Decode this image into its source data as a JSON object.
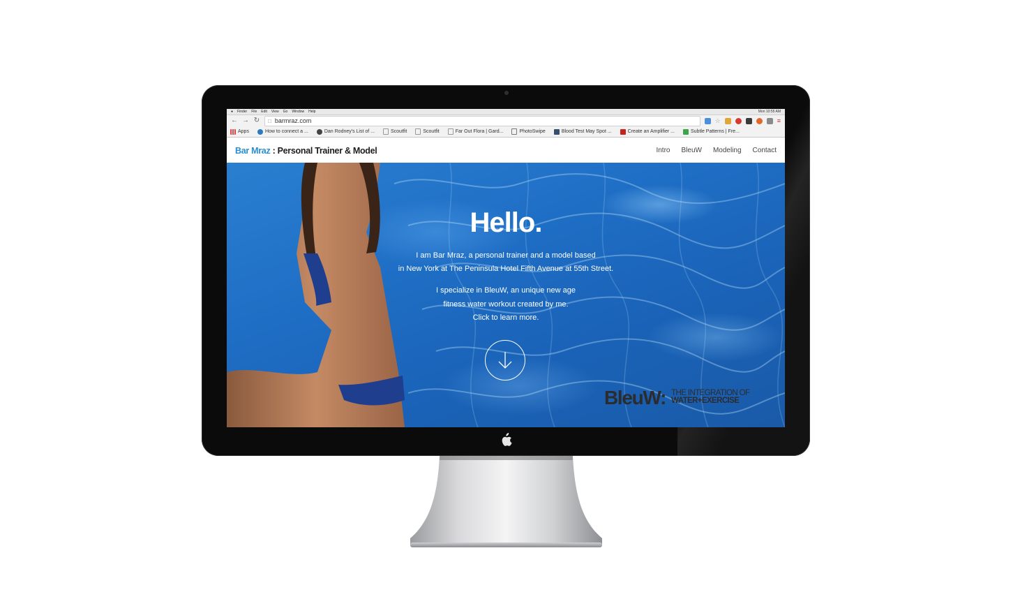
{
  "menubar": {
    "items": [
      "Finder",
      "File",
      "Edit",
      "View",
      "Go",
      "Window",
      "Help"
    ],
    "clock": "Mon 10:55 AM"
  },
  "browser": {
    "url": "barmraz.com",
    "bookmarks": [
      {
        "label": "Apps",
        "icon": "apps-grid-icon"
      },
      {
        "label": "How to connect a ...",
        "icon": "wordpress-icon"
      },
      {
        "label": "Dan Rodney's List of ...",
        "icon": "dr-icon"
      },
      {
        "label": "Scoutfit",
        "icon": "page-icon"
      },
      {
        "label": "Scoutfit",
        "icon": "page-icon"
      },
      {
        "label": "Far Out Flora | Gard...",
        "icon": "page-icon"
      },
      {
        "label": "PhotoSwipe",
        "icon": "ps-icon"
      },
      {
        "label": "Blood Test May Spot ...",
        "icon": "md-icon"
      },
      {
        "label": "Create an Amplifier ...",
        "icon": "red-square-icon"
      },
      {
        "label": "Subtle Patterns | Fre...",
        "icon": "sp-icon"
      }
    ]
  },
  "site": {
    "brand_name": "Bar Mraz",
    "brand_suffix": " : Personal Trainer & Model",
    "nav": [
      "Intro",
      "BleuW",
      "Modeling",
      "Contact"
    ]
  },
  "hero": {
    "heading": "Hello.",
    "intro_line1": "I am Bar Mraz, a personal trainer and a model based",
    "intro_line2": "in New York at The Peninsula Hotel Fifth Avenue at 55th Street.",
    "specialize_line1": "I specialize in BleuW, an unique new age",
    "specialize_line2": "fitness water workout created by me.",
    "specialize_line3": "Click to learn more.",
    "scroll_icon": "arrow-down-circle-icon"
  },
  "logo": {
    "word": "BleuW:",
    "tag_line1": "THE INTEGRATION OF",
    "tag_line2": "WATER+EXERCISE"
  },
  "colors": {
    "brand_blue": "#2a8fd0",
    "pool_blue": "#1f6fc6",
    "bezel": "#0b0b0c",
    "logo_dark": "#2c2c2e"
  }
}
